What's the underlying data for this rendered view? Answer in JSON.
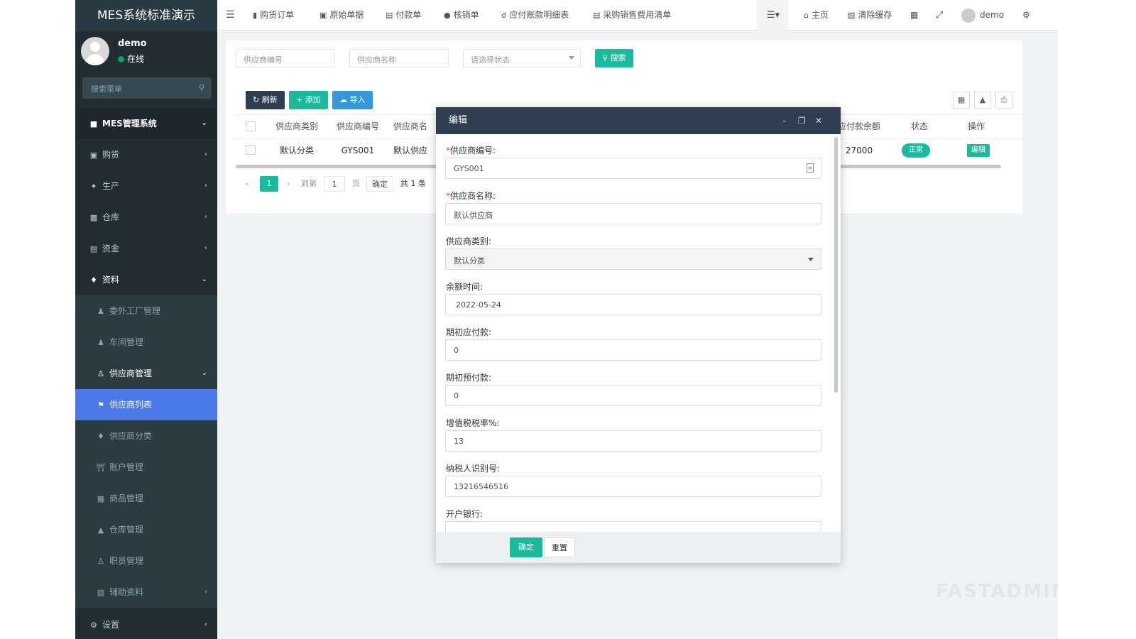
{
  "app_title": "MES系统标准演示",
  "user": {
    "name": "demo",
    "status": "在线"
  },
  "search_menu_placeholder": "搜索菜单",
  "sidebar": [
    {
      "label": "MES管理系统",
      "icon": "graduation-cap-icon"
    },
    {
      "label": "购货",
      "icon": "cart-icon"
    },
    {
      "label": "生产",
      "icon": "production-icon"
    },
    {
      "label": "仓库",
      "icon": "warehouse-icon"
    },
    {
      "label": "资金",
      "icon": "database-icon"
    },
    {
      "label": "资料",
      "icon": "cubes-icon"
    },
    {
      "label": "委外工厂管理",
      "icon": "user-plus-icon"
    },
    {
      "label": "车间管理",
      "icon": "user-plus-icon"
    },
    {
      "label": "供应商管理",
      "icon": "user-icon"
    },
    {
      "label": "供应商列表",
      "icon": "flag-icon"
    },
    {
      "label": "供应商分类",
      "icon": "tag-icon"
    },
    {
      "label": "账户管理",
      "icon": "bank-icon"
    },
    {
      "label": "商品管理",
      "icon": "goods-icon"
    },
    {
      "label": "仓库管理",
      "icon": "truck-icon"
    },
    {
      "label": "职员管理",
      "icon": "user-icon"
    },
    {
      "label": "辅助资料",
      "icon": "trash-icon"
    },
    {
      "label": "设置",
      "icon": "cogs-icon"
    }
  ],
  "topnav": [
    {
      "label": "购货订单",
      "icon": "bar-chart-icon"
    },
    {
      "label": "原始单据",
      "icon": "book-icon"
    },
    {
      "label": "付款单",
      "icon": "database-icon"
    },
    {
      "label": "核销单",
      "icon": "apple-icon"
    },
    {
      "label": "应付账款明细表",
      "icon": "key-icon"
    },
    {
      "label": "采购销售费用清单",
      "icon": "list-icon"
    }
  ],
  "topright": {
    "home": "主页",
    "clear_cache": "清除缓存",
    "user": "demo"
  },
  "filters": {
    "supplier_code_placeholder": "供应商编号",
    "supplier_name_placeholder": "供应商名称",
    "status_placeholder": "请选择状态",
    "search_button": "搜索"
  },
  "toolbar": {
    "refresh": "刷新",
    "add": "添加",
    "import": "导入"
  },
  "table": {
    "headers": [
      "供应商类别",
      "供应商编号",
      "供应商名",
      "应付款余额",
      "状态",
      "操作"
    ],
    "row": {
      "category": "默认分类",
      "code": "GYS001",
      "name": "默认供应",
      "balance": "27000",
      "status": "正常",
      "action": "编辑"
    }
  },
  "pager": {
    "current": "1",
    "goto": "到第",
    "page_input": "1",
    "page_unit": "页",
    "confirm": "确定",
    "total": "共 1 条"
  },
  "modal": {
    "title": "编辑",
    "fields": [
      {
        "label": "供应商编号:",
        "required": true,
        "value": "GYS001"
      },
      {
        "label": "供应商名称:",
        "required": true,
        "value": "默认供应商"
      },
      {
        "label": "供应商类别:",
        "required": false,
        "value": "默认分类"
      },
      {
        "label": "余额时间:",
        "required": false,
        "value": "2022-05-24"
      },
      {
        "label": "期初应付款:",
        "required": false,
        "value": "0"
      },
      {
        "label": "期初预付款:",
        "required": false,
        "value": "0"
      },
      {
        "label": "增值税税率%:",
        "required": false,
        "value": "13"
      },
      {
        "label": "纳税人识别号:",
        "required": false,
        "value": "13216546516"
      },
      {
        "label": "开户银行:",
        "required": false,
        "value": ""
      }
    ],
    "confirm": "确定",
    "reset": "重置"
  },
  "watermark": "FASTADMIN",
  "colors": {
    "sidebar_bg": "#222d32",
    "active": "#4a7ae8",
    "primary_green": "#18bc9c",
    "modal_header": "#2c3e50"
  }
}
